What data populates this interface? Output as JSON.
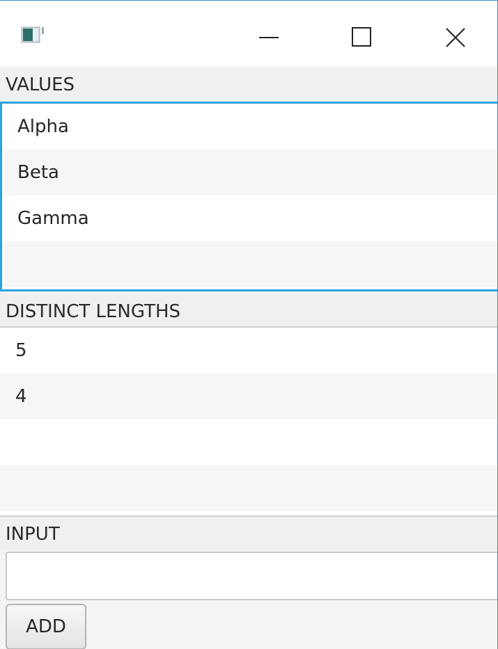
{
  "titlebar": {
    "app_icon": "java-app-icon",
    "buttons": {
      "minimize": "minimize-icon",
      "maximize": "maximize-icon",
      "close": "close-icon"
    }
  },
  "values_section": {
    "label": "VALUES",
    "items": [
      "Alpha",
      "Beta",
      "Gamma"
    ]
  },
  "lengths_section": {
    "label": "DISTINCT LENGTHS",
    "items": [
      "5",
      "4"
    ]
  },
  "input_section": {
    "label": "INPUT",
    "value": "",
    "placeholder": ""
  },
  "add_button": {
    "label": "ADD"
  },
  "colors": {
    "focus_accent": "#2ea2dc",
    "window_border": "#3a8fd6"
  }
}
